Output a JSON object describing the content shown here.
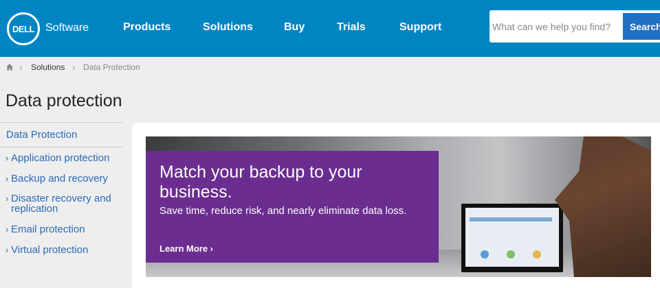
{
  "header": {
    "logo_text": "DELL",
    "logo_subtext": "Software",
    "nav": [
      "Products",
      "Solutions",
      "Buy",
      "Trials",
      "Support"
    ],
    "search_placeholder": "What can we help you find?",
    "search_button": "Search"
  },
  "breadcrumb": {
    "home_icon": "home-icon",
    "items": [
      "Solutions",
      "Data Protection"
    ]
  },
  "page_title": "Data protection",
  "sidebar": {
    "heading": "Data Protection",
    "items": [
      "Application protection",
      "Backup and recovery",
      "Disaster recovery and replication",
      "Email protection",
      "Virtual protection"
    ]
  },
  "hero": {
    "title": "Match your backup to your business.",
    "body": "Save time, reduce risk, and nearly eliminate data loss.",
    "cta": "Learn More ›",
    "promo_color": "#6b2d8f"
  },
  "colors": {
    "header_bg": "#0085c3",
    "link": "#2a6ab7",
    "search_button": "#1f6fc2"
  }
}
